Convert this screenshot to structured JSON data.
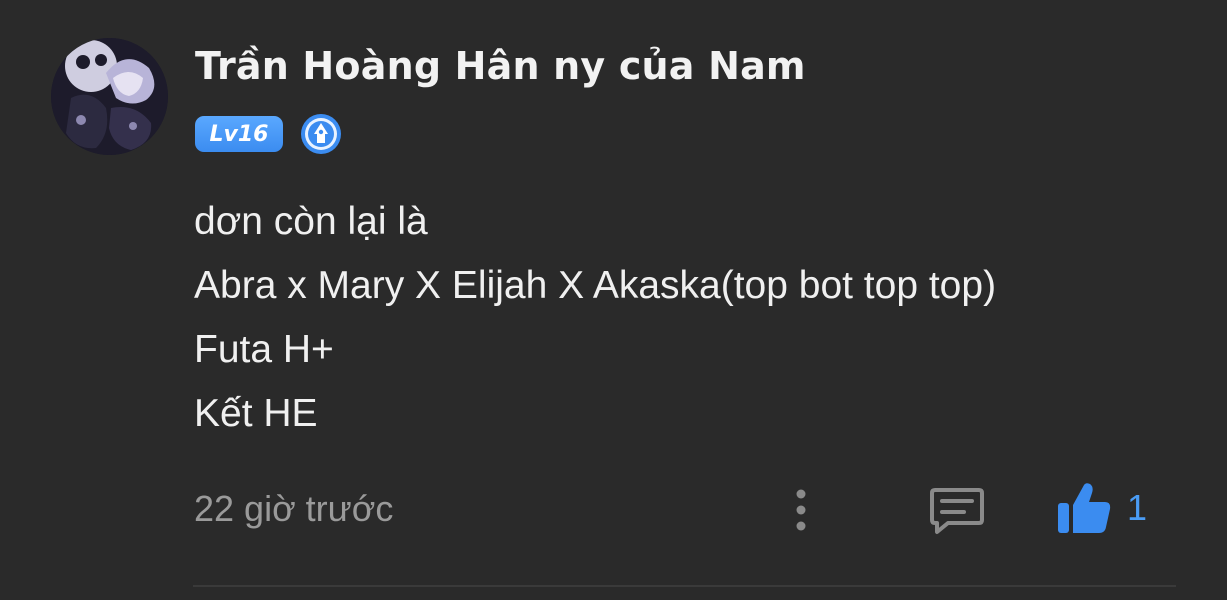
{
  "comment": {
    "author": {
      "name": "Trần Hoàng Hân ny của Nam",
      "level": "Lv16",
      "badge_icon": "author-badge-icon"
    },
    "body_lines": [
      "dơn còn lại là",
      "Abra x Mary X Elijah X Akaska(top bot top top)",
      "Futa H+",
      "Kết HE"
    ],
    "timestamp": "22 giờ trước",
    "actions": {
      "more_icon": "more-vertical-icon",
      "reply_icon": "comment-icon",
      "like_icon": "thumbs-up-icon",
      "like_count": "1"
    }
  },
  "colors": {
    "background": "#2a2a2a",
    "text_primary": "#f0f0f0",
    "text_secondary": "#9a9a9a",
    "accent_blue": "#4a9cf5",
    "level_badge": "#4a9cf5"
  }
}
